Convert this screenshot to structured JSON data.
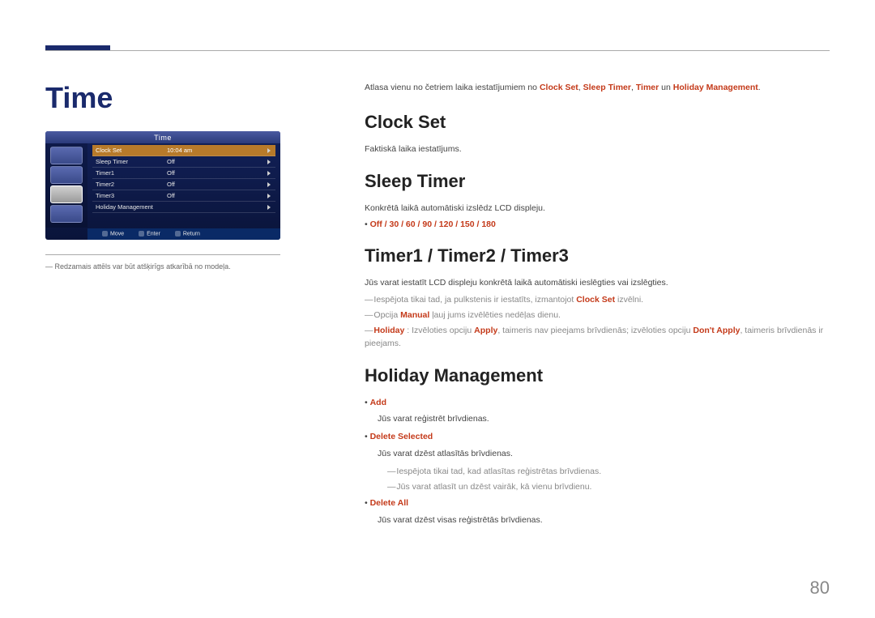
{
  "page_number": "80",
  "left": {
    "title": "Time",
    "osd": {
      "header": "Time",
      "rows": [
        {
          "label": "Clock Set",
          "value": "10:04 am"
        },
        {
          "label": "Sleep Timer",
          "value": "Off"
        },
        {
          "label": "Timer1",
          "value": "Off"
        },
        {
          "label": "Timer2",
          "value": "Off"
        },
        {
          "label": "Timer3",
          "value": "Off"
        },
        {
          "label": "Holiday Management",
          "value": ""
        }
      ],
      "footer": {
        "move": "Move",
        "enter": "Enter",
        "return": "Return"
      }
    },
    "note_prefix": "― ",
    "note": "Redzamais attēls var būt atšķirīgs atkarībā no modeļa."
  },
  "right": {
    "intro_plain_1": "Atlasa vienu no četriem laika iestatījumiem no ",
    "intro_em_1": "Clock Set",
    "intro_sep": ", ",
    "intro_em_2": "Sleep Timer",
    "intro_em_3": "Timer",
    "intro_sep_un": " un ",
    "intro_em_4": "Holiday Management",
    "intro_dot": ".",
    "clock_set": {
      "title": "Clock Set",
      "desc": "Faktiskā laika iestatījums."
    },
    "sleep_timer": {
      "title": "Sleep Timer",
      "desc": "Konkrētā laikā automātiski izslēdz LCD displeju.",
      "values": "Off / 30 / 60 / 90 / 120 / 150 / 180"
    },
    "timers": {
      "title": "Timer1 / Timer2 / Timer3",
      "desc": "Jūs varat iestatīt LCD displeju konkrētā laikā automātiski ieslēgties vai izslēgties.",
      "dash1_pre": "Iespējota tikai tad, ja pulkstenis ir iestatīts, izmantojot ",
      "dash1_em": "Clock Set",
      "dash1_post": " izvēlni.",
      "dash2_pre": "Opcija ",
      "dash2_em": "Manual",
      "dash2_post": " ļauj jums izvēlēties nedēļas dienu.",
      "dash3_em1": "Holiday",
      "dash3_mid1": " : Izvēloties opciju ",
      "dash3_em2": "Apply",
      "dash3_mid2": ", taimeris nav pieejams brīvdienās; izvēloties opciju ",
      "dash3_em3": "Don't Apply",
      "dash3_post": ", taimeris brīvdienās ir pieejams."
    },
    "holiday": {
      "title": "Holiday Management",
      "add_label": "Add",
      "add_desc": "Jūs varat reģistrēt brīvdienas.",
      "del_sel_label": "Delete Selected",
      "del_sel_desc": "Jūs varat dzēst atlasītās brīvdienas.",
      "del_sel_d1": "Iespējota tikai tad, kad atlasītas reģistrētas brīvdienas.",
      "del_sel_d2": "Jūs varat atlasīt un dzēst vairāk, kā vienu brīvdienu.",
      "del_all_label": "Delete All",
      "del_all_desc": "Jūs varat dzēst visas reģistrētās brīvdienas."
    }
  }
}
